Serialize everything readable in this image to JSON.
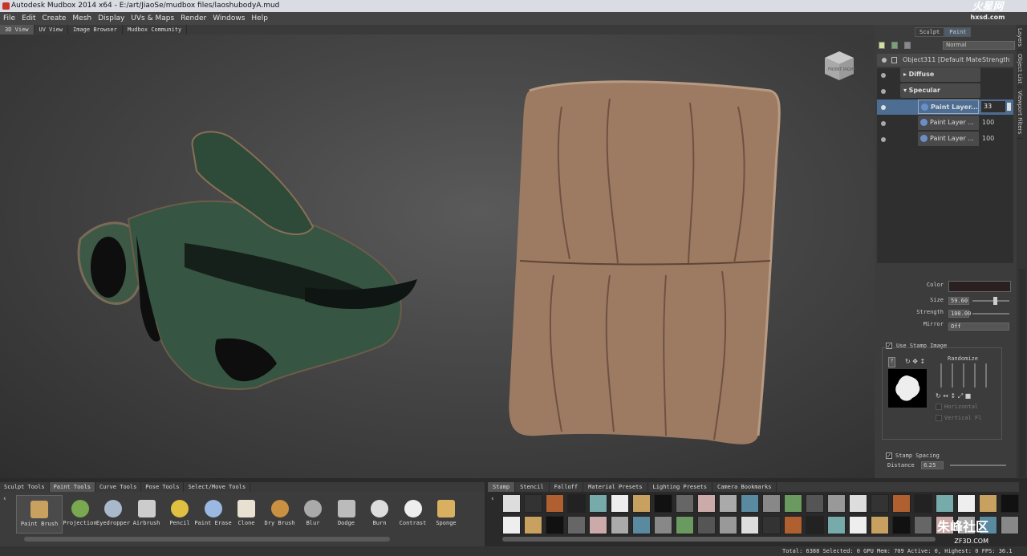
{
  "window": {
    "title": "Autodesk Mudbox 2014 x64 - E:/art/JiaoSe/mudbox files/laoshubodyA.mud"
  },
  "menu": [
    "File",
    "Edit",
    "Create",
    "Mesh",
    "Display",
    "UVs & Maps",
    "Render",
    "Windows",
    "Help"
  ],
  "watermark_top": {
    "main": "火星网",
    "sub": "hxsd.com"
  },
  "view_tabs": [
    {
      "label": "3D View",
      "active": true
    },
    {
      "label": "UV View",
      "active": false
    },
    {
      "label": "Image Browser",
      "active": false
    },
    {
      "label": "Mudbox Community",
      "active": false
    }
  ],
  "mode_tabs": [
    {
      "label": "Sculpt",
      "active": false
    },
    {
      "label": "Paint",
      "active": true
    }
  ],
  "side_tabs": [
    "Layers",
    "Object List",
    "Viewport Filters"
  ],
  "layers": {
    "blend_mode": "Normal",
    "object": "Object311 [Default Mate",
    "strength_header": "Strength",
    "channels": [
      {
        "name": "Diffuse"
      },
      {
        "name": "Specular"
      }
    ],
    "paint_layers": [
      {
        "name": "Paint Layer...",
        "strength": "33",
        "selected": true
      },
      {
        "name": "Paint Layer ...",
        "strength": "100",
        "selected": false
      },
      {
        "name": "Paint Layer ...",
        "strength": "100",
        "selected": false
      }
    ]
  },
  "properties": {
    "color_label": "Color",
    "size_label": "Size",
    "size_value": "59.60",
    "strength_label": "Strength",
    "strength_value": "100.00",
    "mirror_label": "Mirror",
    "mirror_value": "Off",
    "use_stamp_image": "Use Stamp Image",
    "randomize": "Randomize",
    "horizontal": "Horizontal",
    "vertical": "Vertical Fl",
    "stamp_spacing": "Stamp Spacing",
    "distance_label": "Distance",
    "distance_value": "6.25"
  },
  "tool_tabs": [
    {
      "label": "Sculpt Tools",
      "active": false
    },
    {
      "label": "Paint Tools",
      "active": true
    },
    {
      "label": "Curve Tools",
      "active": false
    },
    {
      "label": "Pose Tools",
      "active": false
    },
    {
      "label": "Select/Move Tools",
      "active": false
    }
  ],
  "tools": [
    {
      "label": "Paint Brush",
      "icon": "paint-brush-icon",
      "active": true
    },
    {
      "label": "Projection",
      "icon": "projection-icon",
      "active": false
    },
    {
      "label": "Eyedropper",
      "icon": "eyedropper-icon",
      "active": false
    },
    {
      "label": "Airbrush",
      "icon": "airbrush-icon",
      "active": false
    },
    {
      "label": "Pencil",
      "icon": "pencil-icon",
      "active": false
    },
    {
      "label": "Paint Erase",
      "icon": "eraser-icon",
      "active": false
    },
    {
      "label": "Clone",
      "icon": "clone-stamp-icon",
      "active": false
    },
    {
      "label": "Dry Brush",
      "icon": "dry-brush-icon",
      "active": false
    },
    {
      "label": "Blur",
      "icon": "blur-drop-icon",
      "active": false
    },
    {
      "label": "Dodge",
      "icon": "dodge-icon",
      "active": false
    },
    {
      "label": "Burn",
      "icon": "burn-icon",
      "active": false
    },
    {
      "label": "Contrast",
      "icon": "contrast-icon",
      "active": false
    },
    {
      "label": "Sponge",
      "icon": "sponge-icon",
      "active": false
    }
  ],
  "stamp_tabs": [
    {
      "label": "Stamp",
      "active": true
    },
    {
      "label": "Stencil",
      "active": false
    },
    {
      "label": "Falloff",
      "active": false
    },
    {
      "label": "Material Presets",
      "active": false
    },
    {
      "label": "Lighting Presets",
      "active": false
    },
    {
      "label": "Camera Bookmarks",
      "active": false
    }
  ],
  "status": {
    "text": "Total: 6388  Selected: 0 GPU Mem: 709  Active: 0, Highest: 0  FPS: 36.1"
  },
  "watermark_bottom": {
    "main": "朱峰社区",
    "sub": "ZF3D.COM"
  },
  "viewcube": {
    "front": "FRONT",
    "right": "RIGHT"
  },
  "colors": {
    "accent": "#4e6d93",
    "brush_color": "#2a2020",
    "leather": "#9c7a62",
    "green": "#2f4a38"
  }
}
